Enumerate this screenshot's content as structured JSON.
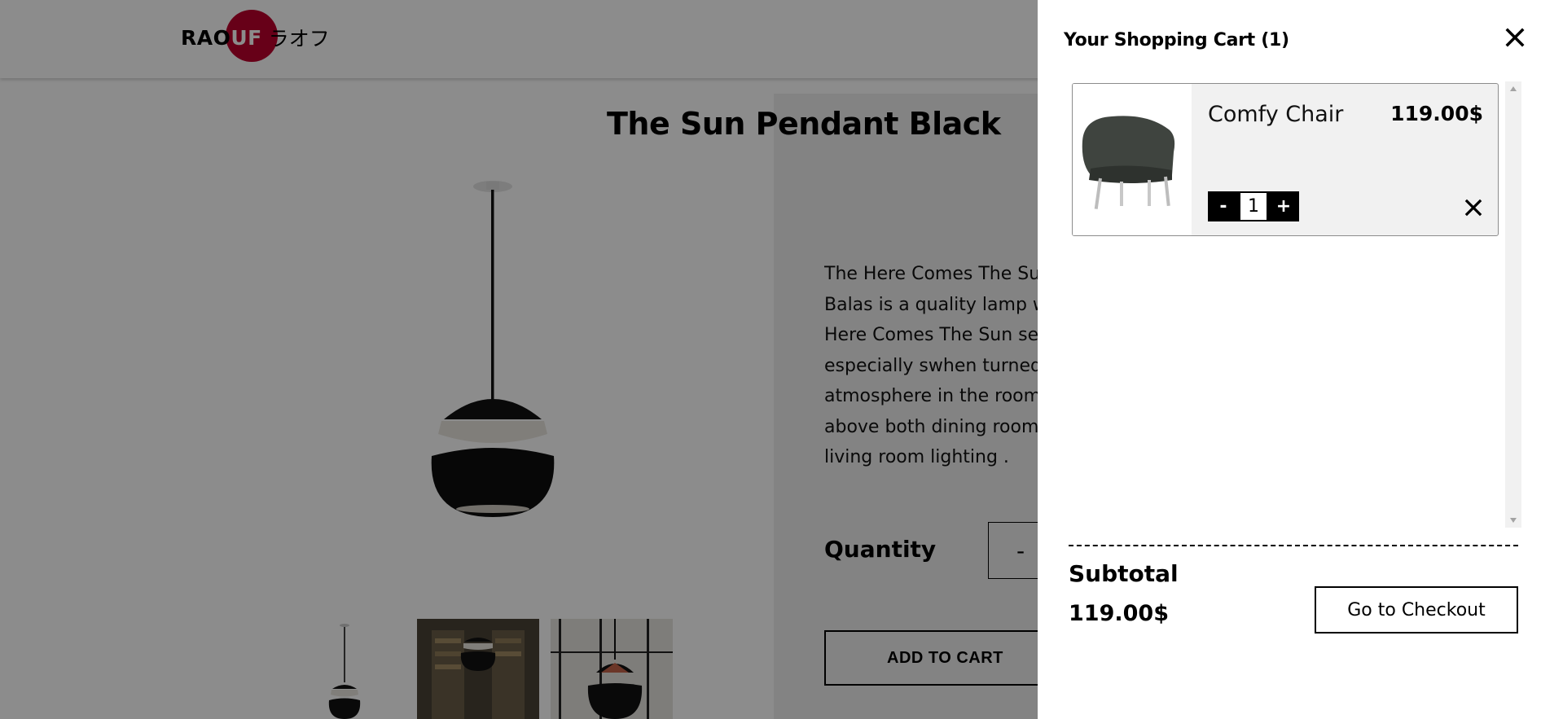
{
  "header": {
    "logo_latin_a": "RAO",
    "logo_latin_b": "UF",
    "logo_japanese": "ラオフ"
  },
  "product": {
    "title": "The Sun Pendant Black",
    "description_lines": [
      "The Here Comes The Sun p",
      "Balas is a quality lamp with",
      "Here Comes The Sun serie",
      "especially swhen turned c",
      "atmosphere in the room it",
      "above both dining room t",
      "living room lighting ."
    ],
    "quantity_label": "Quantity",
    "quantity_minus": "-",
    "add_to_cart_label": "ADD TO CART"
  },
  "cart": {
    "title": "Your Shopping Cart (1)",
    "items": [
      {
        "name": "Comfy Chair",
        "price": "119.00$",
        "quantity": "1",
        "minus_label": "-",
        "plus_label": "+"
      }
    ],
    "subtotal_label": "Subtotal",
    "subtotal_value": "119.00$",
    "checkout_label": "Go to Checkout"
  },
  "colors": {
    "brand_red": "#bc002d",
    "overlay": "rgba(0,0,0,0.45)",
    "button_black": "#000000"
  }
}
